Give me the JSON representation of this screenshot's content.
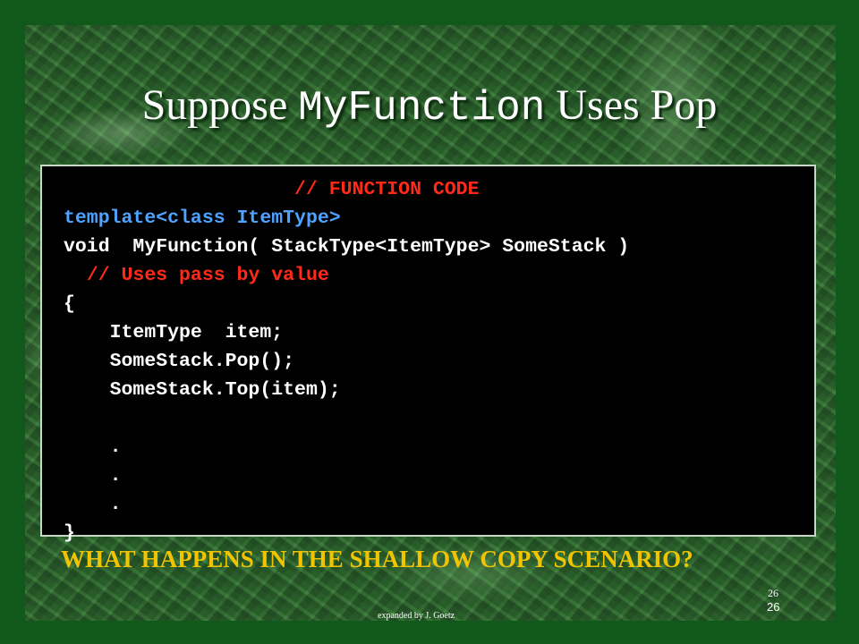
{
  "slide": {
    "title_prefix": "Suppose ",
    "title_code": "MyFunction",
    "title_suffix": " Uses Pop",
    "code_lines": [
      {
        "indent": "                    ",
        "text": "// FUNCTION CODE",
        "kind": "comment"
      },
      {
        "indent": "",
        "text": "template<class ItemType>",
        "kind": "keyword"
      },
      {
        "indent": "",
        "text": "void  MyFunction( StackType<ItemType> SomeStack )",
        "kind": "plain"
      },
      {
        "indent": "  ",
        "text": "// Uses pass by value",
        "kind": "comment"
      },
      {
        "indent": "",
        "text": "{",
        "kind": "plain"
      },
      {
        "indent": "    ",
        "text": "ItemType  item;",
        "kind": "plain"
      },
      {
        "indent": "    ",
        "text": "SomeStack.Pop();",
        "kind": "plain"
      },
      {
        "indent": "    ",
        "text": "SomeStack.Top(item);",
        "kind": "plain"
      },
      {
        "indent": "",
        "text": "",
        "kind": "plain"
      },
      {
        "indent": "    ",
        "text": ".",
        "kind": "plain"
      },
      {
        "indent": "    ",
        "text": ".",
        "kind": "plain"
      },
      {
        "indent": "    ",
        "text": ".",
        "kind": "plain"
      },
      {
        "indent": "",
        "text": "}",
        "kind": "plain"
      }
    ],
    "question": "WHAT HAPPENS IN THE SHALLOW COPY SCENARIO?",
    "page_number_top": "26",
    "page_number_bottom": "26",
    "footer": "expanded by J. Goetz"
  },
  "colors": {
    "title": "#ffffff",
    "code_keyword": "#4da3ff",
    "code_comment": "#ff2a1a",
    "question": "#f2c400"
  }
}
